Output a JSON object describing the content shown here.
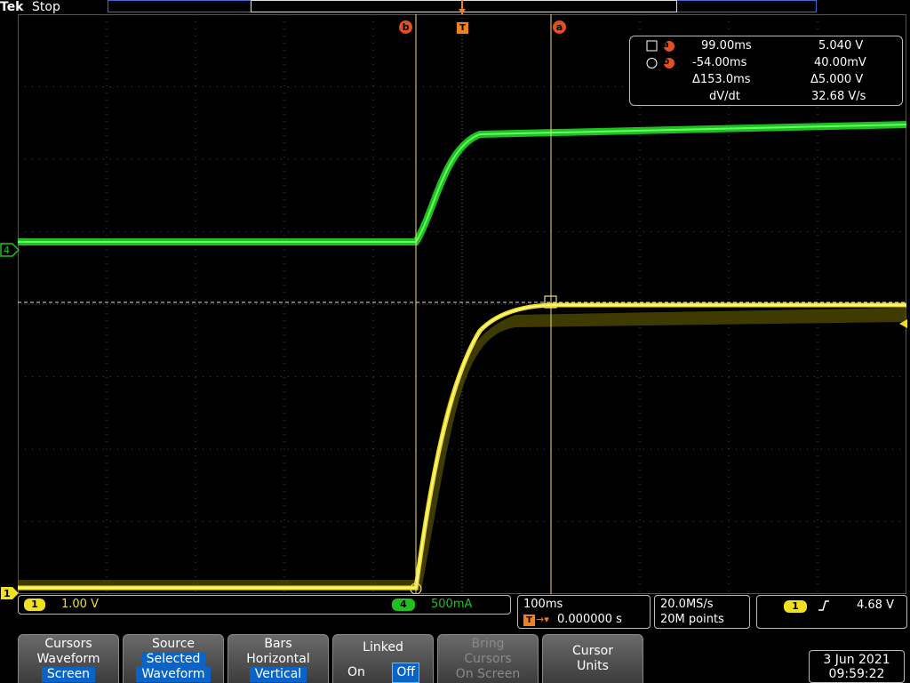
{
  "topbar": {
    "brand": "Tek",
    "run_state": "Stop"
  },
  "markers": {
    "trigger_label": "T",
    "cursor_a_label": "a",
    "cursor_b_label": "b",
    "ch4_marker": "4",
    "ch1_marker": "1"
  },
  "colors": {
    "ch1": "#f0e020",
    "ch4": "#20c020",
    "cursor": "#f0e070",
    "accent": "#0a64c8",
    "cursor_label": "#e05020"
  },
  "readout": {
    "a_time": "99.00ms",
    "a_value": "5.040 V",
    "b_time": "-54.00ms",
    "b_value": "40.00mV",
    "delta_time": "Δ153.0ms",
    "delta_value": "Δ5.000 V",
    "rate_label": "dV/dt",
    "rate_value": "32.68 V/s"
  },
  "status": {
    "ch1_num": "1",
    "ch1_scale": "1.00 V",
    "ch4_num": "4",
    "ch4_scale": "500mA",
    "timebase": "100ms",
    "trigger_delay": "0.000000 s",
    "sample_rate": "20.0MS/s",
    "record_length": "20M points",
    "trig_src": "1",
    "trig_level": "4.68 V"
  },
  "softkeys": [
    {
      "line1": "Cursors",
      "line2": "Waveform",
      "line3": "Screen"
    },
    {
      "line1": "Source",
      "line2": "Selected",
      "line3": "Waveform"
    },
    {
      "line1": "Bars",
      "line2": "Horizontal",
      "line3": "Vertical"
    },
    {
      "line1": "Linked",
      "on": "On",
      "off": "Off"
    },
    {
      "line1": "Bring",
      "line2": "Cursors",
      "line3": "On Screen"
    },
    {
      "line1": "Cursor",
      "line2": "Units"
    }
  ],
  "datetime": {
    "date": "3 Jun 2021",
    "time": "09:59:22"
  }
}
